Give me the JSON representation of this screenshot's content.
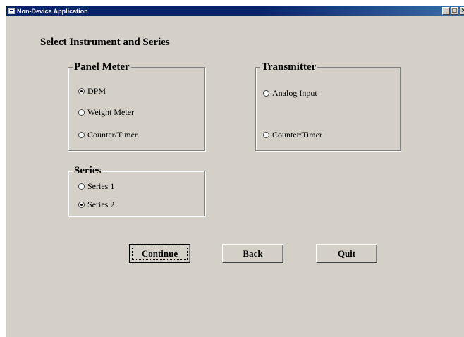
{
  "window": {
    "title": "Non-Device Application",
    "controls": {
      "minimize": "_",
      "maximize": "□",
      "close": "×"
    }
  },
  "heading": "Select Instrument and Series",
  "panel_meter": {
    "legend": "Panel Meter",
    "options": [
      {
        "label": "DPM",
        "checked": true
      },
      {
        "label": "Weight Meter",
        "checked": false
      },
      {
        "label": "Counter/Timer",
        "checked": false
      }
    ]
  },
  "transmitter": {
    "legend": "Transmitter",
    "options": [
      {
        "label": "Analog Input",
        "checked": false
      },
      {
        "label": "Counter/Timer",
        "checked": false
      }
    ]
  },
  "series": {
    "legend": "Series",
    "options": [
      {
        "label": "Series 1",
        "checked": false
      },
      {
        "label": "Series 2",
        "checked": true
      }
    ]
  },
  "buttons": {
    "continue": "Continue",
    "back": "Back",
    "quit": "Quit"
  }
}
